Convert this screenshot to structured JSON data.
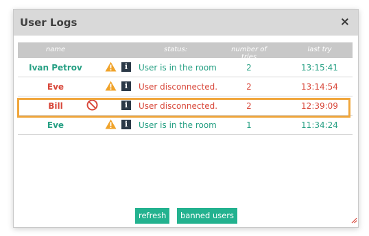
{
  "dialog": {
    "title": "User Logs",
    "close_label": "×"
  },
  "table": {
    "headers": {
      "name": "name",
      "status": "status:",
      "tries": "number of tries",
      "last_try": "last try"
    },
    "rows": [
      {
        "name": "Ivan Petrov",
        "icon": "warning-icon",
        "status": "User is in the room",
        "tries": "2",
        "last_try": "13:15:41",
        "state": "ok"
      },
      {
        "name": "Eve",
        "icon": "warning-icon",
        "status": "User disconnected.",
        "tries": "2",
        "last_try": "13:14:54",
        "state": "bad"
      },
      {
        "name": "Bill",
        "icon": "ban-icon",
        "status": "User disconnected.",
        "tries": "2",
        "last_try": "12:39:09",
        "state": "bad",
        "highlighted": true
      },
      {
        "name": "Eve",
        "icon": "warning-icon",
        "status": "User is in the room",
        "tries": "1",
        "last_try": "11:34:24",
        "state": "ok"
      }
    ],
    "info_glyph": "i"
  },
  "buttons": {
    "refresh": "refresh",
    "banned_users": "banned users"
  },
  "colors": {
    "ok": "#27a084",
    "bad": "#d8473a",
    "accent_button": "#23b28f",
    "highlight": "#f0a63b",
    "header_bg": "#c8c8c8",
    "titlebar_bg": "#d9d9d9"
  }
}
